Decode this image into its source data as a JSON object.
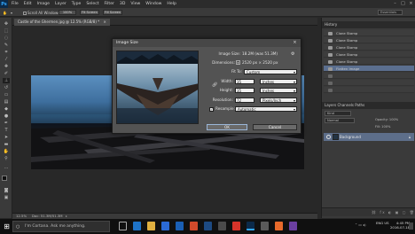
{
  "menubar": {
    "app": "Ps",
    "items": [
      "File",
      "Edit",
      "Image",
      "Layer",
      "Type",
      "Select",
      "Filter",
      "3D",
      "View",
      "Window",
      "Help"
    ]
  },
  "optionsbar": {
    "scroll_all": "Scroll All Windows",
    "zoom_100": "100%",
    "fit_screen": "Fit Screen",
    "fill_screen": "Fill Screen",
    "workspace": "Essentials"
  },
  "document": {
    "tab_title": "Castle of the Ghermen.jpg @ 12.5% (RGB/8) *",
    "status_zoom": "12.5%",
    "status_doc": "Doc: 51.3M/51.3M"
  },
  "history": {
    "title": "History",
    "items": [
      {
        "label": "Clone Stamp",
        "state": "normal"
      },
      {
        "label": "Clone Stamp",
        "state": "normal"
      },
      {
        "label": "Clone Stamp",
        "state": "normal"
      },
      {
        "label": "Clone Stamp",
        "state": "normal"
      },
      {
        "label": "Clone Stamp",
        "state": "normal"
      },
      {
        "label": "Flatten Image",
        "state": "selected"
      },
      {
        "label": "",
        "state": "dim"
      },
      {
        "label": "",
        "state": "dim"
      },
      {
        "label": "",
        "state": "dim"
      }
    ]
  },
  "layers": {
    "tabs": "Layers   Channels   Paths",
    "kind": "Kind",
    "blend": "Normal",
    "opacity": "Opacity: 100%",
    "fill": "Fill: 100%",
    "layer_name": "Background"
  },
  "dialog": {
    "title": "Image Size",
    "image_size_label": "Image Size:",
    "image_size_value": "18.2M (was 51.3M)",
    "dimensions_label": "Dimensions:",
    "dimensions_value": "2520 px  ×  2520 px",
    "fit_to_label": "Fit To:",
    "fit_to_value": "Custom",
    "width_label": "Width:",
    "width_value": "35",
    "width_unit": "Inches",
    "height_label": "Height:",
    "height_value": "35",
    "height_unit": "Inches",
    "resolution_label": "Resolution:",
    "resolution_value": "72",
    "resolution_unit": "Pixels/Inch",
    "resample_label": "Resample:",
    "resample_value": "Automatic",
    "ok": "OK",
    "cancel": "Cancel"
  },
  "taskbar": {
    "search_placeholder": "I'm Cortana. Ask me anything.",
    "lang": "ENG\nUS",
    "time": "4:45 PM",
    "date": "2016-07-18"
  }
}
